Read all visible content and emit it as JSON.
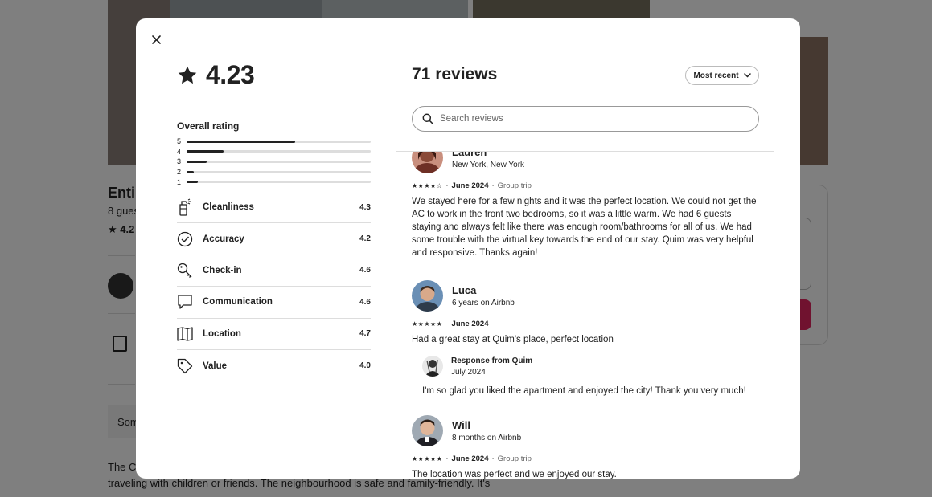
{
  "background": {
    "title": "Entir",
    "subtitle": "8 gues",
    "rating": "4.2",
    "some": "Som",
    "description": "The C bathrooms flat, located at the heart of Barcelona's City Center, perfect for those traveling with children or friends. The neighbourhood is safe and family-friendly. It's"
  },
  "modal": {
    "overall_score": "4.23",
    "overall_label": "Overall rating",
    "distribution": [
      {
        "stars": "5",
        "fraction": 0.59
      },
      {
        "stars": "4",
        "fraction": 0.2
      },
      {
        "stars": "3",
        "fraction": 0.11
      },
      {
        "stars": "2",
        "fraction": 0.04
      },
      {
        "stars": "1",
        "fraction": 0.06
      }
    ],
    "categories": [
      {
        "name": "Cleanliness",
        "value": "4.3",
        "icon": "spray-bottle-icon"
      },
      {
        "name": "Accuracy",
        "value": "4.2",
        "icon": "check-circle-icon"
      },
      {
        "name": "Check-in",
        "value": "4.6",
        "icon": "key-icon"
      },
      {
        "name": "Communication",
        "value": "4.6",
        "icon": "chat-bubble-icon"
      },
      {
        "name": "Location",
        "value": "4.7",
        "icon": "map-icon"
      },
      {
        "name": "Value",
        "value": "4.0",
        "icon": "tag-icon"
      }
    ],
    "reviews_title": "71 reviews",
    "sort_label": "Most recent",
    "search_placeholder": "Search reviews",
    "reviews": [
      {
        "name": "Lauren",
        "sub": "New York, New York",
        "stars": "★★★★☆",
        "date": "June 2024",
        "trip": "Group trip",
        "text": "We stayed here for a few nights and it was the perfect location. We could not get the AC to work in the front two bedrooms, so it was a little warm. We had 6 guests staying and always felt like there was enough room/bathrooms for all of us. We had some trouble with the virtual key towards the end of our stay. Quim was very helpful and responsive. Thanks again!"
      },
      {
        "name": "Luca",
        "sub": "6 years on Airbnb",
        "stars": "★★★★★",
        "date": "June 2024",
        "trip": "",
        "text": "Had a great stay at Quim's place, perfect location",
        "response": {
          "from": "Response from Quim",
          "date": "July 2024",
          "text": "I'm so glad you liked the apartment and enjoyed the city! Thank you very much!"
        }
      },
      {
        "name": "Will",
        "sub": "8 months on Airbnb",
        "stars": "★★★★★",
        "date": "June 2024",
        "trip": "Group trip",
        "text": "The location was perfect and we enjoyed our stay."
      }
    ]
  }
}
